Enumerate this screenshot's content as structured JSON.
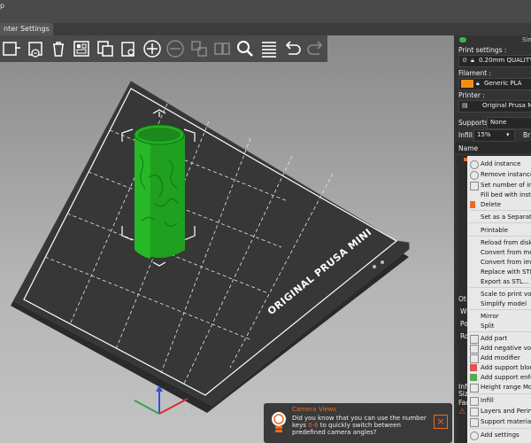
{
  "menu": {
    "fragment": "p"
  },
  "tabs": {
    "printer_settings": "nter Settings"
  },
  "toolbar_icons": [
    "add-icon",
    "delete-icon",
    "delete-all-icon",
    "arrange-icon",
    "copy-icon",
    "paste-icon",
    "add-instance-icon",
    "remove-instance-icon",
    "split-objects-icon",
    "split-parts-icon",
    "search-icon",
    "layers-editing-icon",
    "undo-icon",
    "redo-icon"
  ],
  "bed": {
    "label": "ORIGINAL PRUSA MINI"
  },
  "mode": {
    "label": "Sim"
  },
  "panel": {
    "print_settings_label": "Print settings :",
    "print_settings_value": "0.20mm QUALITY",
    "filament_label": "Filament :",
    "filament_value": "Generic PLA",
    "filament_color": "#f28c12",
    "printer_label": "Printer :",
    "printer_value": "Original Prusa MI",
    "supports_label": "Supports:",
    "supports_value": "None",
    "infill_label": "Infill:",
    "infill_value": "15%",
    "brim_label": "Br",
    "name_header": "Name",
    "fragments": [
      "Ot",
      "W",
      "Po",
      "Ro",
      "Inf",
      "Siz",
      "Fac"
    ]
  },
  "context_menu": {
    "items": [
      "Add instance",
      "Remove instance",
      "Set number of ins",
      "Fill bed with insta",
      "Delete",
      "Set as a Separate",
      "Printable",
      "Reload from disk",
      "Convert from met",
      "Convert from imp",
      "Replace with STL",
      "Export as STL...",
      "Scale to print volu",
      "Simplify model",
      "Mirror",
      "Split",
      "Add part",
      "Add negative volu",
      "Add modifier",
      "Add support bloc",
      "Add support enfo",
      "Height range Mod",
      "Infill",
      "Layers and Perime",
      "Support material",
      "Add settings"
    ]
  },
  "hint": {
    "title": "Camera Views",
    "body_before": "Did you know that you can use the number keys ",
    "keys": "0-6",
    "body_after": " to quickly switch between predefined camera angles?"
  }
}
